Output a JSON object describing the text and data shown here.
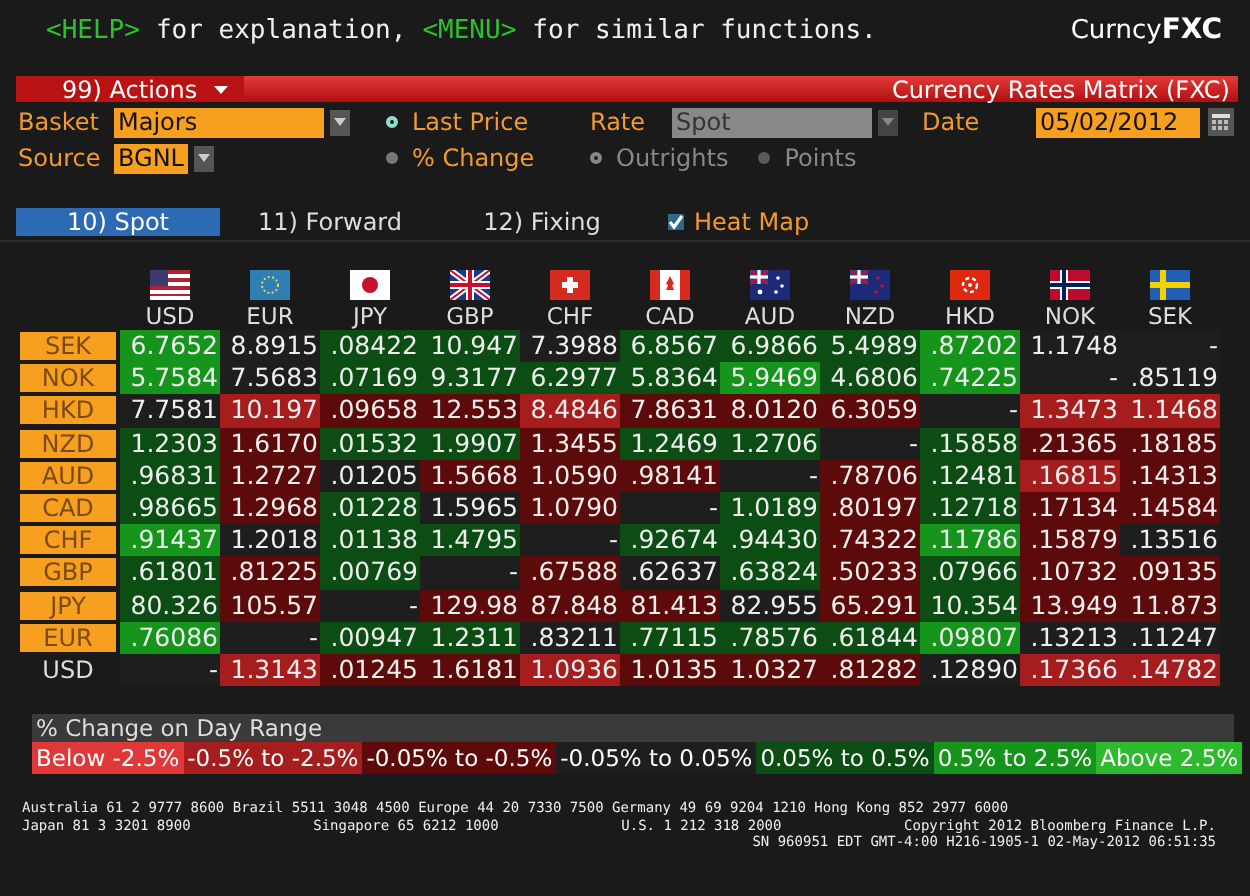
{
  "header": {
    "help_key": "<HELP>",
    "help_text": "for explanation,",
    "menu_key": "<MENU>",
    "menu_text": "for similar functions.",
    "logo_prefix": "Curncy",
    "logo_code": "FXC"
  },
  "action_bar": {
    "menu": "99) Actions",
    "title": "Currency Rates Matrix (FXC)"
  },
  "form": {
    "basket": {
      "label": "Basket",
      "value": "Majors"
    },
    "source": {
      "label": "Source",
      "value": "BGNL"
    },
    "price_mode": [
      {
        "label": "Last Price",
        "selected": true
      },
      {
        "label": "% Change",
        "selected": false
      }
    ],
    "rate": {
      "label": "Rate",
      "value": "Spot",
      "disabled": true
    },
    "quote_mode": [
      {
        "label": "Outrights",
        "selected": true,
        "disabled": true
      },
      {
        "label": "Points",
        "selected": false,
        "disabled": true
      }
    ],
    "date": {
      "label": "Date",
      "value": "05/02/2012"
    }
  },
  "tabs": [
    {
      "label": "10) Spot",
      "selected": true
    },
    {
      "label": "11) Forward",
      "selected": false
    },
    {
      "label": "12) Fixing",
      "selected": false
    }
  ],
  "heat_map": {
    "label": "Heat Map",
    "checked": true
  },
  "matrix": {
    "columns": [
      {
        "code": "USD"
      },
      {
        "code": "EUR"
      },
      {
        "code": "JPY"
      },
      {
        "code": "GBP"
      },
      {
        "code": "CHF"
      },
      {
        "code": "CAD"
      },
      {
        "code": "AUD"
      },
      {
        "code": "NZD"
      },
      {
        "code": "HKD"
      },
      {
        "code": "NOK"
      },
      {
        "code": "SEK"
      }
    ],
    "rows": [
      {
        "label": "SEK",
        "kind": "button",
        "cells": [
          {
            "value": "6.7652",
            "color": "#16951c"
          },
          {
            "value": "8.8915",
            "color": "#1e1e1e"
          },
          {
            "value": ".08422",
            "color": "#0b4d12"
          },
          {
            "value": "10.947",
            "color": "#0b4d12"
          },
          {
            "value": "7.3988",
            "color": "#1e1e1e"
          },
          {
            "value": "6.8567",
            "color": "#0b4d12"
          },
          {
            "value": "6.9866",
            "color": "#0b4d12"
          },
          {
            "value": "5.4989",
            "color": "#0b4d12"
          },
          {
            "value": ".87202",
            "color": "#16951c"
          },
          {
            "value": "1.1748",
            "color": "#1e1e1e"
          },
          {
            "value": "-",
            "color": "#1e1e1e"
          }
        ]
      },
      {
        "label": "NOK",
        "kind": "button",
        "cells": [
          {
            "value": "5.7584",
            "color": "#16951c"
          },
          {
            "value": "7.5683",
            "color": "#1e1e1e"
          },
          {
            "value": ".07169",
            "color": "#0b4d12"
          },
          {
            "value": "9.3177",
            "color": "#0b4d12"
          },
          {
            "value": "6.2977",
            "color": "#0b4d12"
          },
          {
            "value": "5.8364",
            "color": "#0b4d12"
          },
          {
            "value": "5.9469",
            "color": "#16951c"
          },
          {
            "value": "4.6806",
            "color": "#0b4d12"
          },
          {
            "value": ".74225",
            "color": "#16951c"
          },
          {
            "value": "-",
            "color": "#1e1e1e"
          },
          {
            "value": ".85119",
            "color": "#1e1e1e"
          }
        ]
      },
      {
        "label": "HKD",
        "kind": "button",
        "cells": [
          {
            "value": "7.7581",
            "color": "#1e1e1e"
          },
          {
            "value": "10.197",
            "color": "#a51d1d"
          },
          {
            "value": ".09658",
            "color": "#5c0a0a"
          },
          {
            "value": "12.553",
            "color": "#5c0a0a"
          },
          {
            "value": "8.4846",
            "color": "#a51d1d"
          },
          {
            "value": "7.8631",
            "color": "#5c0a0a"
          },
          {
            "value": "8.0120",
            "color": "#5c0a0a"
          },
          {
            "value": "6.3059",
            "color": "#5c0a0a"
          },
          {
            "value": "-",
            "color": "#1e1e1e"
          },
          {
            "value": "1.3473",
            "color": "#a51d1d"
          },
          {
            "value": "1.1468",
            "color": "#a51d1d"
          }
        ]
      },
      {
        "label": "NZD",
        "kind": "button",
        "cells": [
          {
            "value": "1.2303",
            "color": "#0b4d12"
          },
          {
            "value": "1.6170",
            "color": "#5c0a0a"
          },
          {
            "value": ".01532",
            "color": "#0b4d12"
          },
          {
            "value": "1.9907",
            "color": "#0b4d12"
          },
          {
            "value": "1.3455",
            "color": "#5c0a0a"
          },
          {
            "value": "1.2469",
            "color": "#0b4d12"
          },
          {
            "value": "1.2706",
            "color": "#0b4d12"
          },
          {
            "value": "-",
            "color": "#1e1e1e"
          },
          {
            "value": ".15858",
            "color": "#0b4d12"
          },
          {
            "value": ".21365",
            "color": "#5c0a0a"
          },
          {
            "value": ".18185",
            "color": "#5c0a0a"
          }
        ]
      },
      {
        "label": "AUD",
        "kind": "button",
        "cells": [
          {
            "value": ".96831",
            "color": "#0b4d12"
          },
          {
            "value": "1.2727",
            "color": "#5c0a0a"
          },
          {
            "value": ".01205",
            "color": "#1e1e1e"
          },
          {
            "value": "1.5668",
            "color": "#5c0a0a"
          },
          {
            "value": "1.0590",
            "color": "#5c0a0a"
          },
          {
            "value": ".98141",
            "color": "#5c0a0a"
          },
          {
            "value": "-",
            "color": "#1e1e1e"
          },
          {
            "value": ".78706",
            "color": "#5c0a0a"
          },
          {
            "value": ".12481",
            "color": "#0b4d12"
          },
          {
            "value": ".16815",
            "color": "#a51d1d"
          },
          {
            "value": ".14313",
            "color": "#5c0a0a"
          }
        ]
      },
      {
        "label": "CAD",
        "kind": "button",
        "cells": [
          {
            "value": ".98665",
            "color": "#0b4d12"
          },
          {
            "value": "1.2968",
            "color": "#5c0a0a"
          },
          {
            "value": ".01228",
            "color": "#0b4d12"
          },
          {
            "value": "1.5965",
            "color": "#1e1e1e"
          },
          {
            "value": "1.0790",
            "color": "#5c0a0a"
          },
          {
            "value": "-",
            "color": "#1e1e1e"
          },
          {
            "value": "1.0189",
            "color": "#0b4d12"
          },
          {
            "value": ".80197",
            "color": "#5c0a0a"
          },
          {
            "value": ".12718",
            "color": "#0b4d12"
          },
          {
            "value": ".17134",
            "color": "#5c0a0a"
          },
          {
            "value": ".14584",
            "color": "#5c0a0a"
          }
        ]
      },
      {
        "label": "CHF",
        "kind": "button",
        "cells": [
          {
            "value": ".91437",
            "color": "#16951c"
          },
          {
            "value": "1.2018",
            "color": "#1e1e1e"
          },
          {
            "value": ".01138",
            "color": "#0b4d12"
          },
          {
            "value": "1.4795",
            "color": "#0b4d12"
          },
          {
            "value": "-",
            "color": "#1e1e1e"
          },
          {
            "value": ".92674",
            "color": "#0b4d12"
          },
          {
            "value": ".94430",
            "color": "#0b4d12"
          },
          {
            "value": ".74322",
            "color": "#5c0a0a"
          },
          {
            "value": ".11786",
            "color": "#16951c"
          },
          {
            "value": ".15879",
            "color": "#5c0a0a"
          },
          {
            "value": ".13516",
            "color": "#1e1e1e"
          }
        ]
      },
      {
        "label": "GBP",
        "kind": "button",
        "cells": [
          {
            "value": ".61801",
            "color": "#0b4d12"
          },
          {
            "value": ".81225",
            "color": "#5c0a0a"
          },
          {
            "value": ".00769",
            "color": "#0b4d12"
          },
          {
            "value": "-",
            "color": "#1e1e1e"
          },
          {
            "value": ".67588",
            "color": "#5c0a0a"
          },
          {
            "value": ".62637",
            "color": "#1e1e1e"
          },
          {
            "value": ".63824",
            "color": "#0b4d12"
          },
          {
            "value": ".50233",
            "color": "#5c0a0a"
          },
          {
            "value": ".07966",
            "color": "#0b4d12"
          },
          {
            "value": ".10732",
            "color": "#5c0a0a"
          },
          {
            "value": ".09135",
            "color": "#5c0a0a"
          }
        ]
      },
      {
        "label": "JPY",
        "kind": "button",
        "cells": [
          {
            "value": "80.326",
            "color": "#0b4d12"
          },
          {
            "value": "105.57",
            "color": "#5c0a0a"
          },
          {
            "value": "-",
            "color": "#1e1e1e"
          },
          {
            "value": "129.98",
            "color": "#5c0a0a"
          },
          {
            "value": "87.848",
            "color": "#5c0a0a"
          },
          {
            "value": "81.413",
            "color": "#5c0a0a"
          },
          {
            "value": "82.955",
            "color": "#1e1e1e"
          },
          {
            "value": "65.291",
            "color": "#5c0a0a"
          },
          {
            "value": "10.354",
            "color": "#0b4d12"
          },
          {
            "value": "13.949",
            "color": "#5c0a0a"
          },
          {
            "value": "11.873",
            "color": "#5c0a0a"
          }
        ]
      },
      {
        "label": "EUR",
        "kind": "button",
        "cells": [
          {
            "value": ".76086",
            "color": "#16951c"
          },
          {
            "value": "-",
            "color": "#1e1e1e"
          },
          {
            "value": ".00947",
            "color": "#0b4d12"
          },
          {
            "value": "1.2311",
            "color": "#0b4d12"
          },
          {
            "value": ".83211",
            "color": "#1e1e1e"
          },
          {
            "value": ".77115",
            "color": "#0b4d12"
          },
          {
            "value": ".78576",
            "color": "#0b4d12"
          },
          {
            "value": ".61844",
            "color": "#0b4d12"
          },
          {
            "value": ".09807",
            "color": "#16951c"
          },
          {
            "value": ".13213",
            "color": "#1e1e1e"
          },
          {
            "value": ".11247",
            "color": "#1e1e1e"
          }
        ]
      },
      {
        "label": "USD",
        "kind": "plain",
        "cells": [
          {
            "value": "-",
            "color": "#1e1e1e"
          },
          {
            "value": "1.3143",
            "color": "#a51d1d"
          },
          {
            "value": ".01245",
            "color": "#5c0a0a"
          },
          {
            "value": "1.6181",
            "color": "#5c0a0a"
          },
          {
            "value": "1.0936",
            "color": "#a51d1d"
          },
          {
            "value": "1.0135",
            "color": "#5c0a0a"
          },
          {
            "value": "1.0327",
            "color": "#5c0a0a"
          },
          {
            "value": ".81282",
            "color": "#5c0a0a"
          },
          {
            "value": ".12890",
            "color": "#1e1e1e"
          },
          {
            "value": ".17366",
            "color": "#a51d1d"
          },
          {
            "value": ".14782",
            "color": "#a51d1d"
          }
        ]
      }
    ]
  },
  "legend": {
    "title": "% Change on Day Range",
    "items": [
      {
        "label": "Below -2.5%",
        "color": "#e03838"
      },
      {
        "label": "-0.5% to -2.5%",
        "color": "#a51d1d"
      },
      {
        "label": "-0.05% to -0.5%",
        "color": "#5c0a0a"
      },
      {
        "label": "-0.05% to 0.05%",
        "color": "#1e1e1e"
      },
      {
        "label": "0.05% to 0.5%",
        "color": "#0b4d12"
      },
      {
        "label": "0.5% to 2.5%",
        "color": "#16951c"
      },
      {
        "label": "Above 2.5%",
        "color": "#2dbb2d"
      }
    ]
  },
  "footer": {
    "line_1": "Australia 61 2 9777 8600 Brazil 5511 3048 4500 Europe 44 20 7330 7500 Germany 49 69 9204 1210 Hong Kong 852 2977 6000",
    "line_2": [
      "Japan 81 3 3201 8900",
      "Singapore 65 6212 1000",
      "U.S. 1 212 318 2000",
      "Copyright 2012 Bloomberg Finance L.P."
    ],
    "line_3": "SN 960951 EDT  GMT-4:00 H216-1905-1 02-May-2012 06:51:35"
  }
}
